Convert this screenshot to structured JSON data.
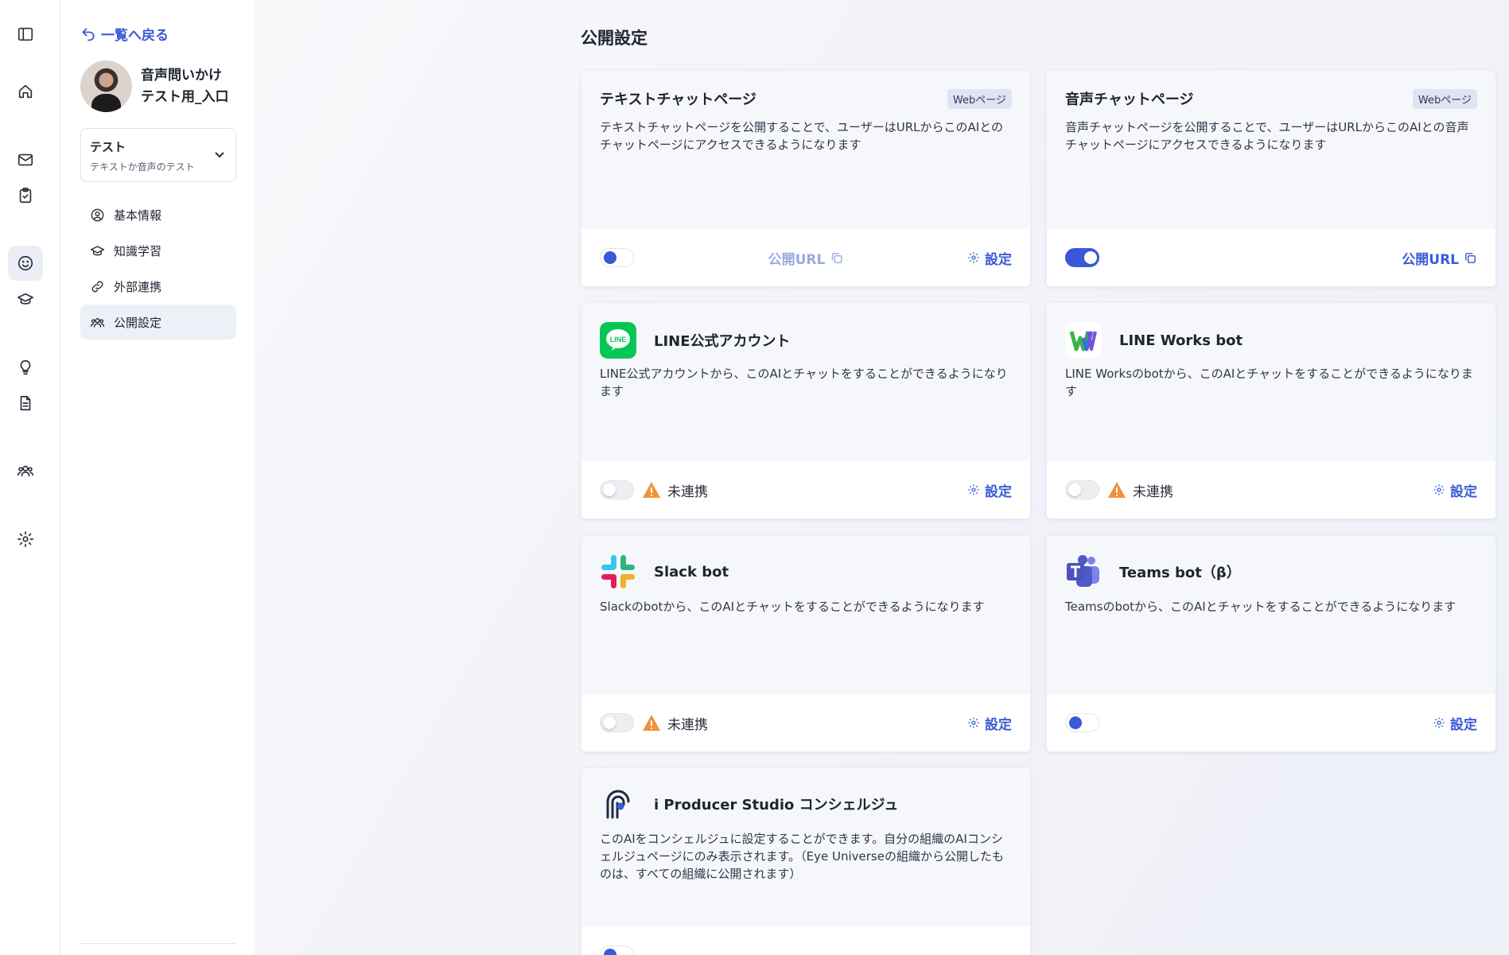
{
  "sidebar": {
    "back_label": "一覧へ戻る",
    "profile_name_line1": "音声問いかけ",
    "profile_name_line2": "テスト用_入口",
    "select": {
      "title": "テスト",
      "subtitle": "テキストか音声のテスト"
    },
    "nav": [
      {
        "label": "基本情報",
        "icon": "user-circle-icon"
      },
      {
        "label": "知識学習",
        "icon": "graduation-cap-icon"
      },
      {
        "label": "外部連携",
        "icon": "link-icon"
      },
      {
        "label": "公開設定",
        "icon": "people-icon",
        "active": true
      }
    ]
  },
  "rail": [
    "sidebar-toggle-icon",
    "home-icon",
    "mail-icon",
    "clipboard-check-icon",
    "smile-icon",
    "graduation-cap-icon",
    "lightbulb-icon",
    "document-icon",
    "people-icon",
    "gear-icon"
  ],
  "main": {
    "page_title": "公開設定",
    "cards": [
      {
        "title": "テキストチャットページ",
        "badge": "Webページ",
        "description": "テキストチャットページを公開することで、ユーザーはURLからこのAIとのチャットページにアクセスできるようになります",
        "public_url_label": "公開URL",
        "settings_label": "設定"
      },
      {
        "title": "音声チャットページ",
        "badge": "Webページ",
        "description": "音声チャットページを公開することで、ユーザーはURLからこのAIとの音声チャットページにアクセスできるようになります",
        "public_url_label": "公開URL"
      },
      {
        "title": "LINE公式アカウント",
        "description": "LINE公式アカウントから、このAIとチャットをすることができるようになります",
        "status": "未連携",
        "settings_label": "設定",
        "logo_text": "LINE"
      },
      {
        "title": "LINE Works bot",
        "description": "LINE Worksのbotから、このAIとチャットをすることができるようになります",
        "status": "未連携",
        "settings_label": "設定"
      },
      {
        "title": "Slack bot",
        "description": "Slackのbotから、このAIとチャットをすることができるようになります",
        "status": "未連携",
        "settings_label": "設定"
      },
      {
        "title": "Teams bot（β）",
        "description": "Teamsのbotから、このAIとチャットをすることができるようになります",
        "settings_label": "設定"
      },
      {
        "title": "i Producer Studio コンシェルジュ",
        "description": "このAIをコンシェルジュに設定することができます。自分の組織のAIコンシェルジュページにのみ表示されます。（Eye Universeの組織から公開したものは、すべての組織に公開されます）"
      }
    ]
  },
  "colors": {
    "accent": "#3b5bd6",
    "warning": "#f0923a",
    "line_green": "#06c755"
  }
}
